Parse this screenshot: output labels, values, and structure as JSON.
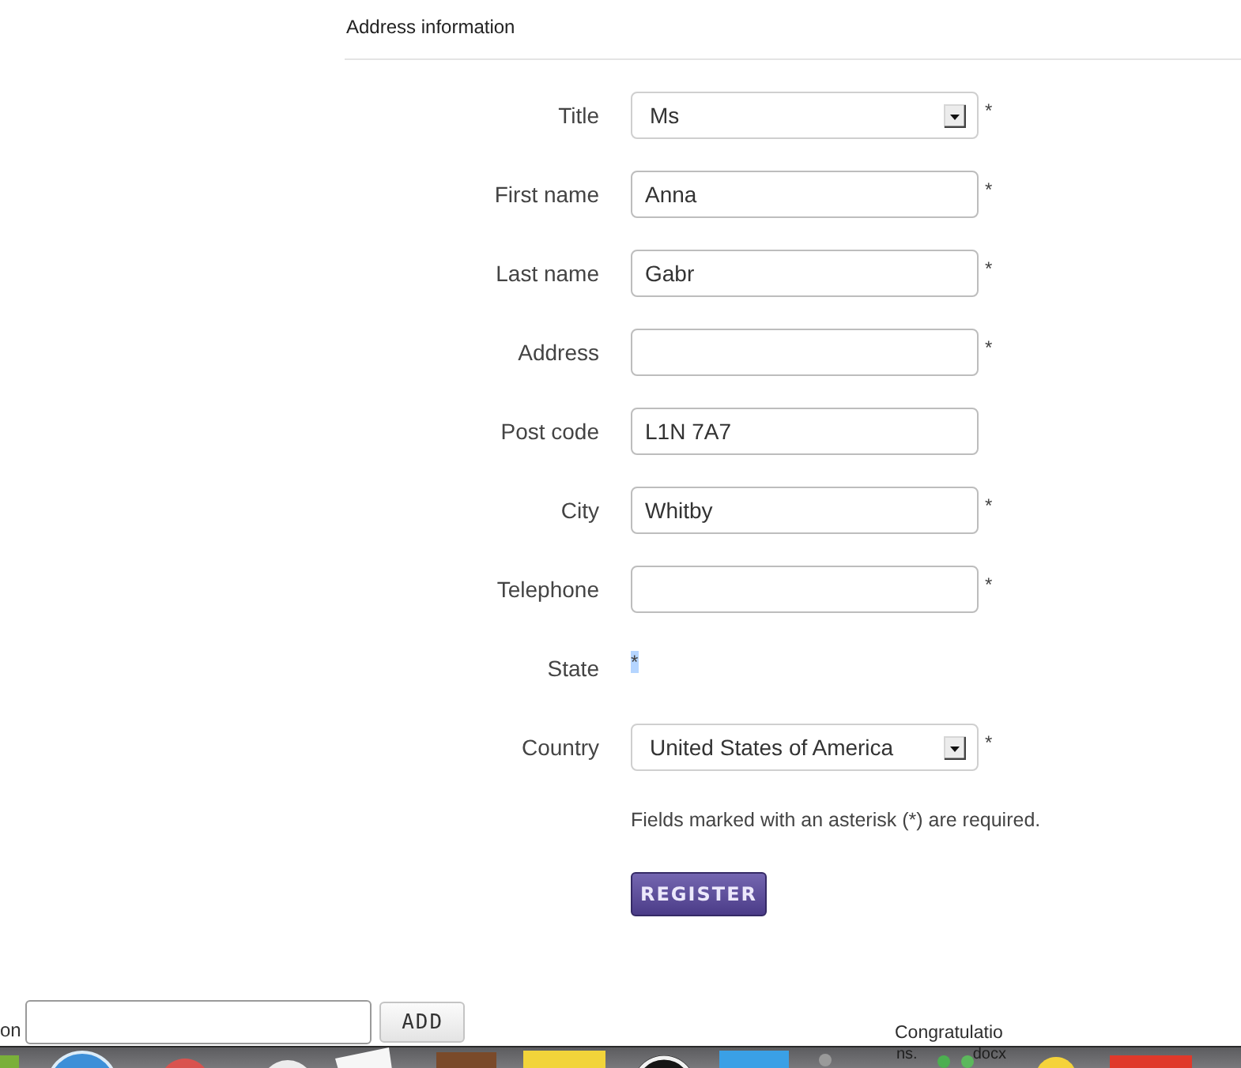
{
  "section": {
    "title": "Address information"
  },
  "fields": [
    {
      "label": "Title",
      "kind": "select",
      "value": "Ms",
      "asterisk": "*",
      "asterisk_selected": false
    },
    {
      "label": "First name",
      "kind": "text",
      "value": "Anna",
      "asterisk": "*",
      "asterisk_selected": false
    },
    {
      "label": "Last name",
      "kind": "text",
      "value": "Gabr",
      "asterisk": "*",
      "asterisk_selected": false
    },
    {
      "label": "Address",
      "kind": "text",
      "asterisk": "*",
      "asterisk_selected": false
    },
    {
      "label": "Post code",
      "kind": "text",
      "value": "L1N 7A7"
    },
    {
      "label": "City",
      "kind": "text",
      "value": "Whitby",
      "asterisk": "*",
      "asterisk_selected": false
    },
    {
      "label": "Telephone",
      "kind": "text",
      "asterisk": "*",
      "asterisk_selected": false
    },
    {
      "label": "State",
      "kind": "none",
      "asterisk": "*",
      "asterisk_selected": true
    },
    {
      "label": "Country",
      "kind": "select",
      "value": "United States of America",
      "asterisk": "*",
      "asterisk_selected": false
    }
  ],
  "note": "Fields marked with an asterisk (*) are required.",
  "submit_button": "REGISTER",
  "add_row": {
    "label": "on",
    "button": "ADD"
  },
  "dock": {
    "file_label": "Congratulatio",
    "file_label_continued": [
      "ns.",
      "docx"
    ]
  }
}
